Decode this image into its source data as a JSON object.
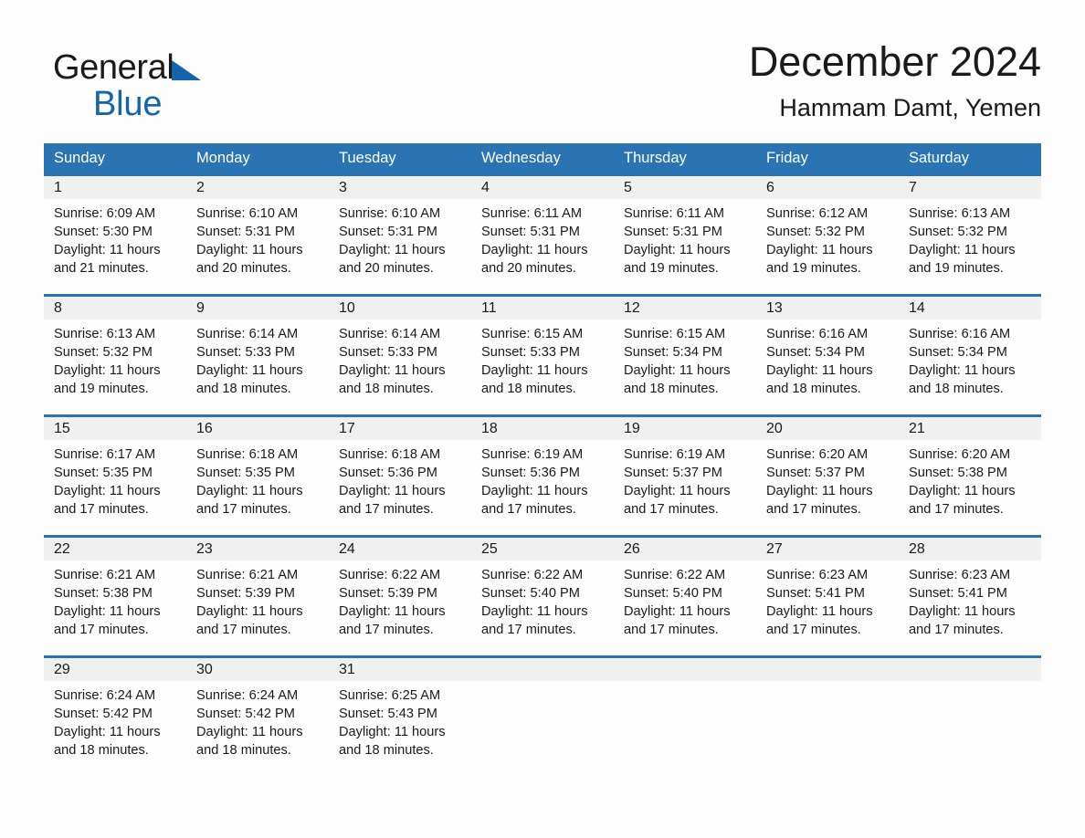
{
  "brand": {
    "word1": "General",
    "word2": "Blue",
    "triangle_color": "#1464ab"
  },
  "header": {
    "month_title": "December 2024",
    "location": "Hammam Damt, Yemen"
  },
  "theme": {
    "header_blue": "#2b74b3",
    "daynum_band": "#f0f0f0",
    "page_background": "#fdfdfd",
    "text": "#1a1a1a"
  },
  "calendar": {
    "weekday_headers": [
      "Sunday",
      "Monday",
      "Tuesday",
      "Wednesday",
      "Thursday",
      "Friday",
      "Saturday"
    ],
    "weeks": [
      [
        {
          "day": "1",
          "sunrise": "Sunrise: 6:09 AM",
          "sunset": "Sunset: 5:30 PM",
          "daylight": "Daylight: 11 hours and 21 minutes."
        },
        {
          "day": "2",
          "sunrise": "Sunrise: 6:10 AM",
          "sunset": "Sunset: 5:31 PM",
          "daylight": "Daylight: 11 hours and 20 minutes."
        },
        {
          "day": "3",
          "sunrise": "Sunrise: 6:10 AM",
          "sunset": "Sunset: 5:31 PM",
          "daylight": "Daylight: 11 hours and 20 minutes."
        },
        {
          "day": "4",
          "sunrise": "Sunrise: 6:11 AM",
          "sunset": "Sunset: 5:31 PM",
          "daylight": "Daylight: 11 hours and 20 minutes."
        },
        {
          "day": "5",
          "sunrise": "Sunrise: 6:11 AM",
          "sunset": "Sunset: 5:31 PM",
          "daylight": "Daylight: 11 hours and 19 minutes."
        },
        {
          "day": "6",
          "sunrise": "Sunrise: 6:12 AM",
          "sunset": "Sunset: 5:32 PM",
          "daylight": "Daylight: 11 hours and 19 minutes."
        },
        {
          "day": "7",
          "sunrise": "Sunrise: 6:13 AM",
          "sunset": "Sunset: 5:32 PM",
          "daylight": "Daylight: 11 hours and 19 minutes."
        }
      ],
      [
        {
          "day": "8",
          "sunrise": "Sunrise: 6:13 AM",
          "sunset": "Sunset: 5:32 PM",
          "daylight": "Daylight: 11 hours and 19 minutes."
        },
        {
          "day": "9",
          "sunrise": "Sunrise: 6:14 AM",
          "sunset": "Sunset: 5:33 PM",
          "daylight": "Daylight: 11 hours and 18 minutes."
        },
        {
          "day": "10",
          "sunrise": "Sunrise: 6:14 AM",
          "sunset": "Sunset: 5:33 PM",
          "daylight": "Daylight: 11 hours and 18 minutes."
        },
        {
          "day": "11",
          "sunrise": "Sunrise: 6:15 AM",
          "sunset": "Sunset: 5:33 PM",
          "daylight": "Daylight: 11 hours and 18 minutes."
        },
        {
          "day": "12",
          "sunrise": "Sunrise: 6:15 AM",
          "sunset": "Sunset: 5:34 PM",
          "daylight": "Daylight: 11 hours and 18 minutes."
        },
        {
          "day": "13",
          "sunrise": "Sunrise: 6:16 AM",
          "sunset": "Sunset: 5:34 PM",
          "daylight": "Daylight: 11 hours and 18 minutes."
        },
        {
          "day": "14",
          "sunrise": "Sunrise: 6:16 AM",
          "sunset": "Sunset: 5:34 PM",
          "daylight": "Daylight: 11 hours and 18 minutes."
        }
      ],
      [
        {
          "day": "15",
          "sunrise": "Sunrise: 6:17 AM",
          "sunset": "Sunset: 5:35 PM",
          "daylight": "Daylight: 11 hours and 17 minutes."
        },
        {
          "day": "16",
          "sunrise": "Sunrise: 6:18 AM",
          "sunset": "Sunset: 5:35 PM",
          "daylight": "Daylight: 11 hours and 17 minutes."
        },
        {
          "day": "17",
          "sunrise": "Sunrise: 6:18 AM",
          "sunset": "Sunset: 5:36 PM",
          "daylight": "Daylight: 11 hours and 17 minutes."
        },
        {
          "day": "18",
          "sunrise": "Sunrise: 6:19 AM",
          "sunset": "Sunset: 5:36 PM",
          "daylight": "Daylight: 11 hours and 17 minutes."
        },
        {
          "day": "19",
          "sunrise": "Sunrise: 6:19 AM",
          "sunset": "Sunset: 5:37 PM",
          "daylight": "Daylight: 11 hours and 17 minutes."
        },
        {
          "day": "20",
          "sunrise": "Sunrise: 6:20 AM",
          "sunset": "Sunset: 5:37 PM",
          "daylight": "Daylight: 11 hours and 17 minutes."
        },
        {
          "day": "21",
          "sunrise": "Sunrise: 6:20 AM",
          "sunset": "Sunset: 5:38 PM",
          "daylight": "Daylight: 11 hours and 17 minutes."
        }
      ],
      [
        {
          "day": "22",
          "sunrise": "Sunrise: 6:21 AM",
          "sunset": "Sunset: 5:38 PM",
          "daylight": "Daylight: 11 hours and 17 minutes."
        },
        {
          "day": "23",
          "sunrise": "Sunrise: 6:21 AM",
          "sunset": "Sunset: 5:39 PM",
          "daylight": "Daylight: 11 hours and 17 minutes."
        },
        {
          "day": "24",
          "sunrise": "Sunrise: 6:22 AM",
          "sunset": "Sunset: 5:39 PM",
          "daylight": "Daylight: 11 hours and 17 minutes."
        },
        {
          "day": "25",
          "sunrise": "Sunrise: 6:22 AM",
          "sunset": "Sunset: 5:40 PM",
          "daylight": "Daylight: 11 hours and 17 minutes."
        },
        {
          "day": "26",
          "sunrise": "Sunrise: 6:22 AM",
          "sunset": "Sunset: 5:40 PM",
          "daylight": "Daylight: 11 hours and 17 minutes."
        },
        {
          "day": "27",
          "sunrise": "Sunrise: 6:23 AM",
          "sunset": "Sunset: 5:41 PM",
          "daylight": "Daylight: 11 hours and 17 minutes."
        },
        {
          "day": "28",
          "sunrise": "Sunrise: 6:23 AM",
          "sunset": "Sunset: 5:41 PM",
          "daylight": "Daylight: 11 hours and 17 minutes."
        }
      ],
      [
        {
          "day": "29",
          "sunrise": "Sunrise: 6:24 AM",
          "sunset": "Sunset: 5:42 PM",
          "daylight": "Daylight: 11 hours and 18 minutes."
        },
        {
          "day": "30",
          "sunrise": "Sunrise: 6:24 AM",
          "sunset": "Sunset: 5:42 PM",
          "daylight": "Daylight: 11 hours and 18 minutes."
        },
        {
          "day": "31",
          "sunrise": "Sunrise: 6:25 AM",
          "sunset": "Sunset: 5:43 PM",
          "daylight": "Daylight: 11 hours and 18 minutes."
        },
        {
          "day": "",
          "sunrise": "",
          "sunset": "",
          "daylight": ""
        },
        {
          "day": "",
          "sunrise": "",
          "sunset": "",
          "daylight": ""
        },
        {
          "day": "",
          "sunrise": "",
          "sunset": "",
          "daylight": ""
        },
        {
          "day": "",
          "sunrise": "",
          "sunset": "",
          "daylight": ""
        }
      ]
    ]
  }
}
